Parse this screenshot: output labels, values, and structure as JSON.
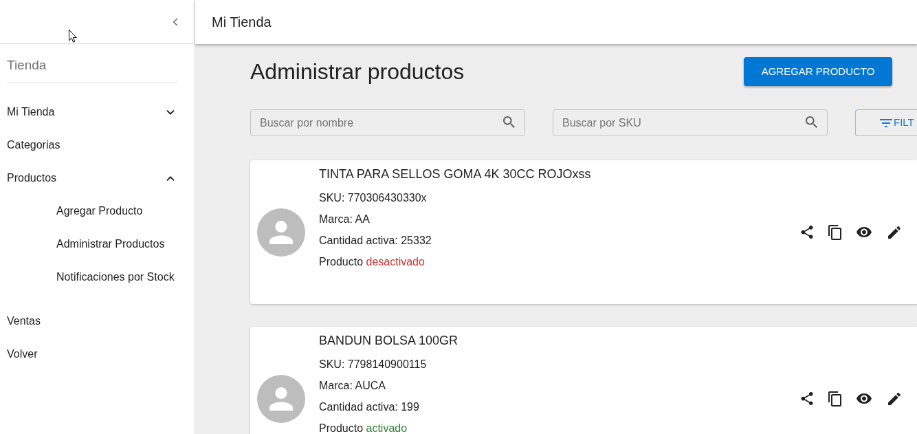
{
  "sidebar": {
    "store_label": "Tienda",
    "items": [
      {
        "kind": "group",
        "label": "Mi Tienda",
        "expanded": false
      },
      {
        "kind": "link",
        "label": "Categorias"
      },
      {
        "kind": "group",
        "label": "Productos",
        "expanded": true,
        "children": [
          {
            "label": "Agregar Producto"
          },
          {
            "label": "Administrar Productos"
          },
          {
            "label": "Notificaciones por Stock"
          }
        ]
      },
      {
        "kind": "link",
        "label": "Ventas"
      },
      {
        "kind": "link",
        "label": "Volver"
      }
    ]
  },
  "app_bar": {
    "title": "Mi Tienda"
  },
  "page": {
    "title": "Administrar productos",
    "add_button": "AGREGAR PRODUCTO"
  },
  "filters": {
    "name_search": {
      "placeholder": "Buscar por nombre"
    },
    "sku_search": {
      "placeholder": "Buscar por SKU"
    },
    "filter_button": "FILT"
  },
  "products": [
    {
      "name": "TINTA PARA SELLOS GOMA 4K 30CC ROJOxss",
      "sku": "SKU: 770306430330x",
      "brand": "Marca: AA",
      "quantity": "Cantidad activa: 25332",
      "status_label": "Producto",
      "status": "desactivado",
      "active": false
    },
    {
      "name": "BANDUN BOLSA 100GR",
      "sku": "SKU: 7798140900115",
      "brand": "Marca: AUCA",
      "quantity": "Cantidad activa: 199",
      "status_label": "Producto",
      "status": "activado",
      "active": true
    }
  ]
}
